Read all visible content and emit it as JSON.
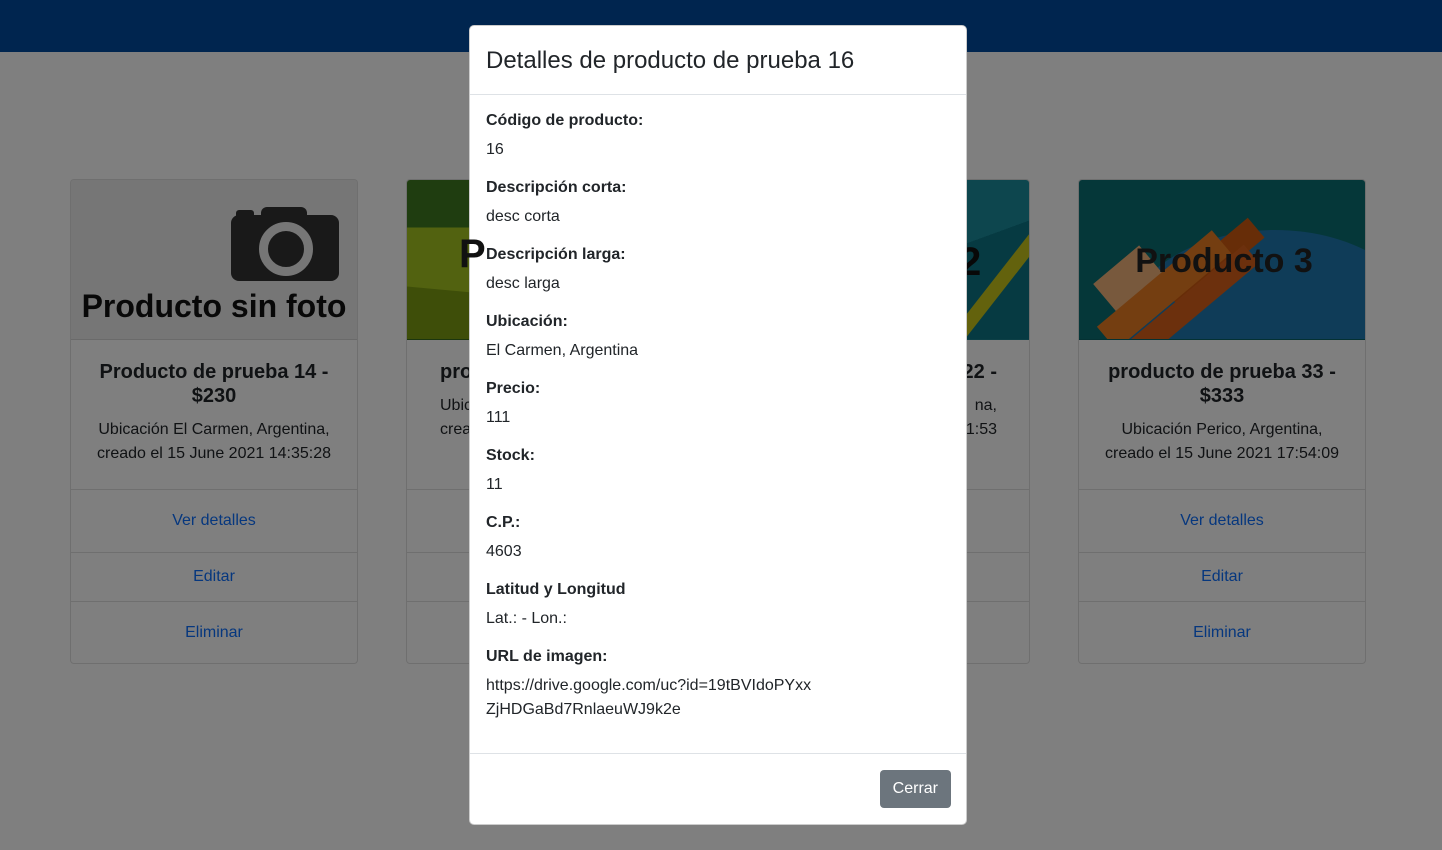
{
  "app": {
    "navbar_color": "#004a9f",
    "accent": "#0d6efd"
  },
  "cards": [
    {
      "image_text": "Producto sin foto",
      "image_icon": "camera-icon",
      "title": "Producto de prueba 14 - $230",
      "text": "Ubicación El Carmen, Argentina, creado el 15 June 2021 14:35:28",
      "details_label": "Ver detalles",
      "edit_label": "Editar",
      "delete_label": "Eliminar"
    },
    {
      "image_text": "P",
      "title": "pro",
      "text": "Ubic crea",
      "details_label": "",
      "edit_label": "",
      "delete_label": ""
    },
    {
      "image_text": "2",
      "title": "22 -",
      "text": "na, 1:53",
      "details_label": "",
      "edit_label": "",
      "delete_label": ""
    },
    {
      "image_text": "Producto 3",
      "title": "producto de prueba 33 - $333",
      "text": "Ubicación Perico, Argentina, creado el 15 June 2021 17:54:09",
      "details_label": "Ver detalles",
      "edit_label": "Editar",
      "delete_label": "Eliminar"
    }
  ],
  "modal": {
    "title": "Detalles de producto de prueba 16",
    "fields": [
      {
        "label": "Código de producto:",
        "value": "16"
      },
      {
        "label": "Descripción corta:",
        "value": "desc corta"
      },
      {
        "label": "Descripción larga:",
        "value": "desc larga"
      },
      {
        "label": "Ubicación:",
        "value": "El Carmen, Argentina"
      },
      {
        "label": "Precio:",
        "value": "111"
      },
      {
        "label": "Stock:",
        "value": "11"
      },
      {
        "label": "C.P.:",
        "value": "4603"
      },
      {
        "label": "Latitud y Longitud",
        "value": "Lat.: - Lon.:"
      },
      {
        "label": "URL de imagen:",
        "value": "https://drive.google.com/uc?id=19tBVIdoPYxxZjHDGaBd7RnlaeuWJ9k2e"
      }
    ],
    "close_label": "Cerrar"
  }
}
